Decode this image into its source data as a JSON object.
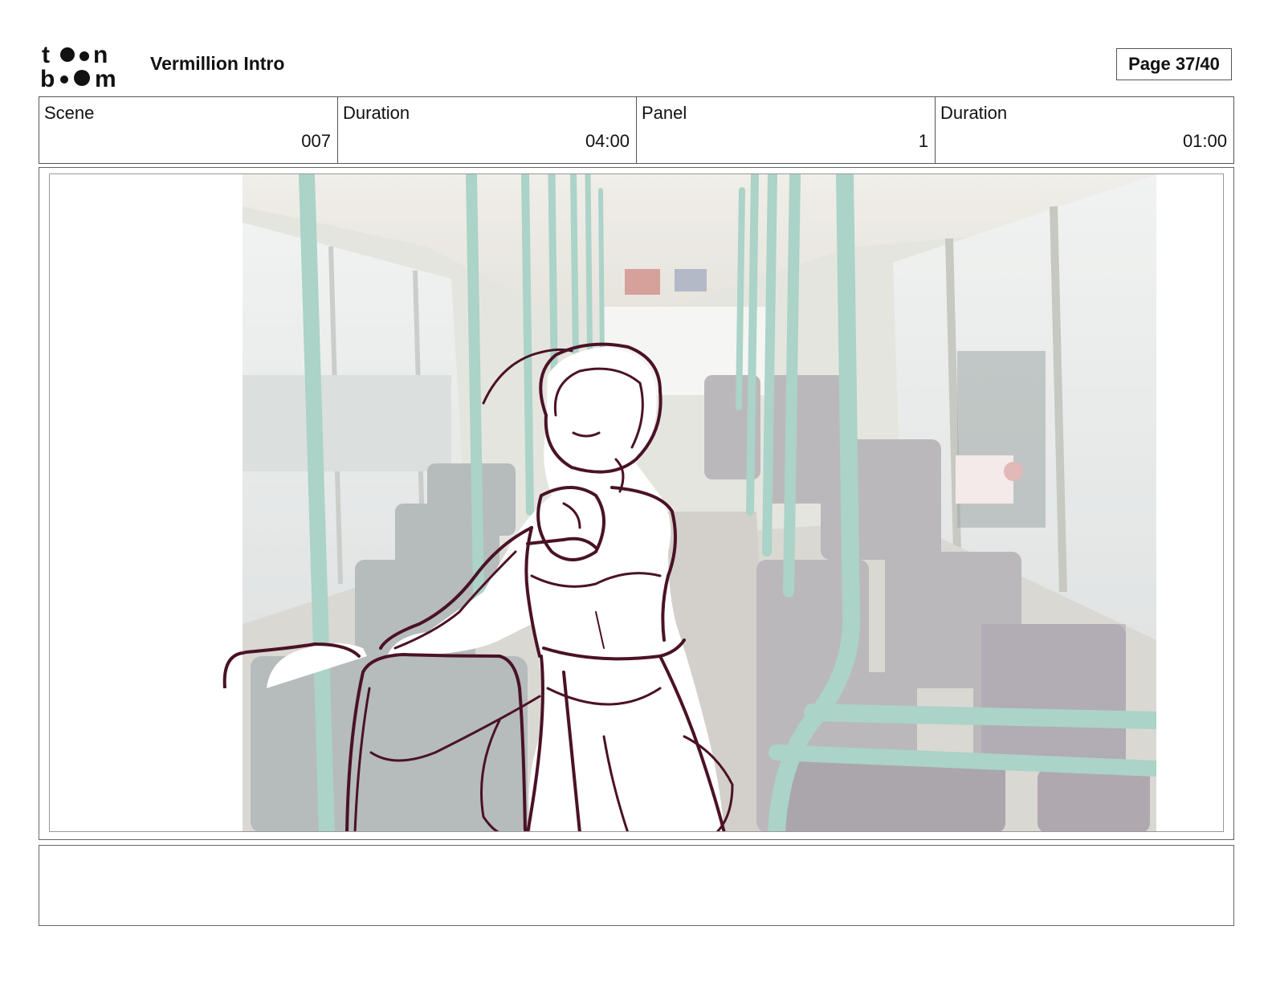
{
  "header": {
    "logo": {
      "name": "toon-boom-logo",
      "top_text": "to•n",
      "bottom_text": "b••m"
    },
    "project_title": "Vermillion Intro",
    "page_indicator": "Page 37/40"
  },
  "info_fields": [
    {
      "label": "Scene",
      "value": "007"
    },
    {
      "label": "Duration",
      "value": "04:00"
    },
    {
      "label": "Panel",
      "value": "1"
    },
    {
      "label": "Duration",
      "value": "01:00"
    }
  ],
  "panel": {
    "background": "bus interior photo with teal grab poles and grey seats",
    "overlay": "rough sketch of a figure pointing toward viewer",
    "sketch_color": "#4a1226",
    "pole_color": "#8fc4b5"
  },
  "notes": {
    "text": ""
  }
}
